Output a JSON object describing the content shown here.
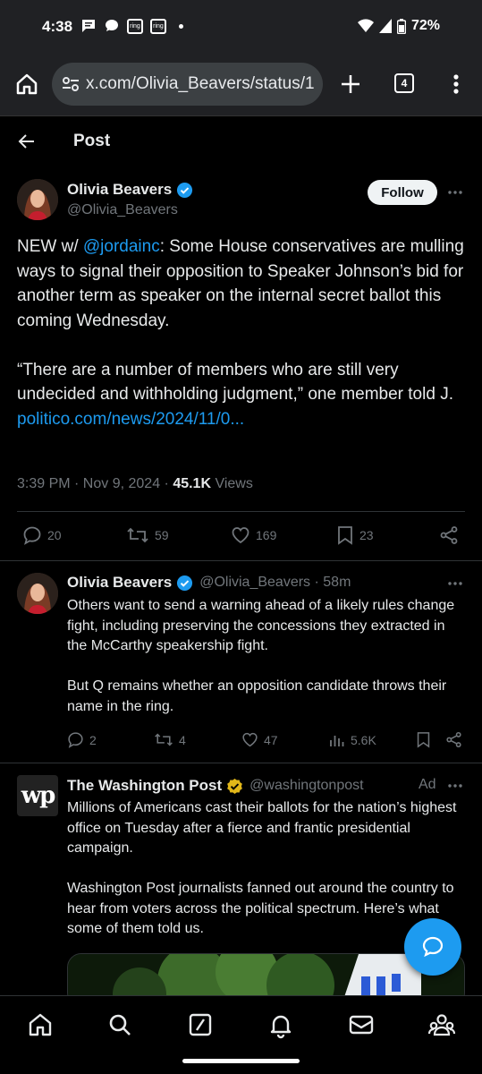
{
  "status_bar": {
    "time": "4:38",
    "battery": "72%",
    "ring_label": "ring"
  },
  "browser": {
    "url": "x.com/Olivia_Beavers/status/1",
    "tab_count": "4"
  },
  "header": {
    "title": "Post"
  },
  "main_tweet": {
    "name": "Olivia Beavers",
    "handle": "@Olivia_Beavers",
    "follow_label": "Follow",
    "text_prefix": "NEW w/ ",
    "mention": "@jordainc",
    "text_p1_rest": ": Some House conservatives are mulling ways to signal their opposition to Speaker Johnson’s bid for another term as speaker on the internal secret ballot this coming Wednesday.",
    "text_p2": "“There are a number of members who are still very undecided and withholding judgment,” one member told J.",
    "link": "politico.com/news/2024/11/0...",
    "timestamp": "3:39 PM · Nov 9, 2024 · ",
    "views_count": "45.1K",
    "views_label": " Views",
    "replies": "20",
    "reposts": "59",
    "likes": "169",
    "bookmarks": "23"
  },
  "reply_tweet": {
    "name": "Olivia Beavers",
    "handle_time": "@Olivia_Beavers · 58m",
    "text_p1": "Others want to send a warning ahead of a likely rules change fight, including preserving the concessions they extracted in the McCarthy speakership fight.",
    "text_p2": "But Q remains whether an opposition candidate throws their name in the ring.",
    "replies": "2",
    "reposts": "4",
    "likes": "47",
    "views": "5.6K"
  },
  "ad_tweet": {
    "name": "The Washington Post",
    "handle": "@washingtonpost",
    "ad_label": "Ad",
    "logo_text": "wp",
    "text_p1": "Millions of Americans cast their ballots for the nation’s highest office on Tuesday after a fierce and frantic presidential campaign.",
    "text_p2": "Washington Post journalists fanned out around the country to hear from voters across the political spectrum. Here’s what some of them told us."
  },
  "colors": {
    "accent": "#1d9bf0",
    "background": "#000000",
    "text": "#e7e9ea",
    "muted": "#71767b",
    "verified_gold": "#e2b719"
  },
  "icons": {
    "nav": [
      "home-icon",
      "search-icon",
      "grok-icon",
      "notifications-icon",
      "messages-icon",
      "communities-icon"
    ]
  }
}
